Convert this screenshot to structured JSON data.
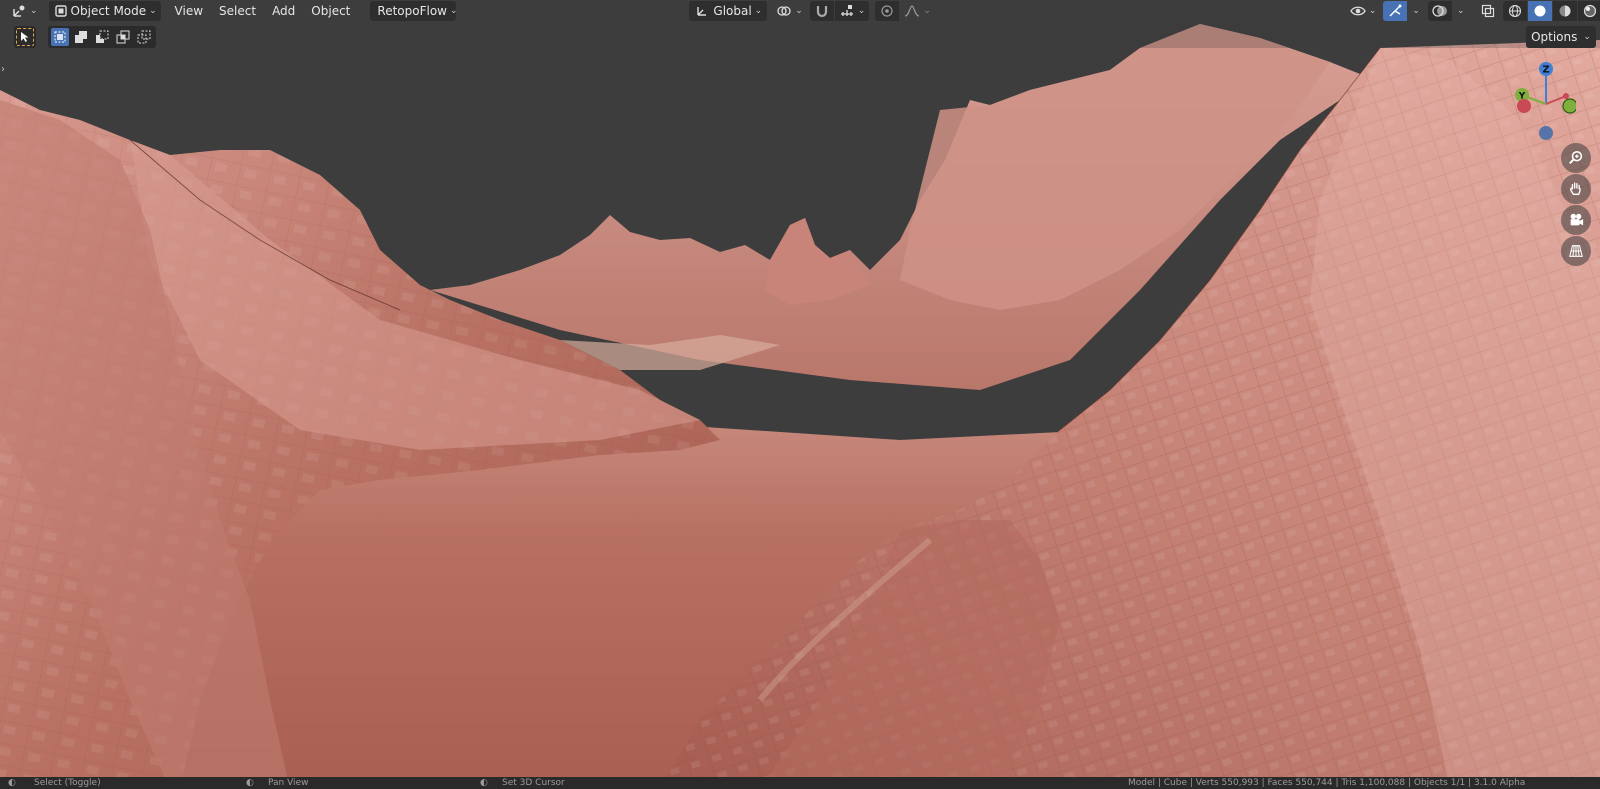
{
  "header": {
    "editor_type_icon": "3d-viewport-icon",
    "mode": {
      "icon": "object-mode-icon",
      "label": "Object Mode"
    },
    "menus": [
      "View",
      "Select",
      "Add",
      "Object"
    ],
    "addon_menu": "RetopoFlow",
    "transform_orientation": {
      "icon": "transform-orientation-icon",
      "label": "Global"
    },
    "pivot_icon": "pivot-point-icon",
    "snap_icon": "snap-magnet-icon",
    "snap_target_icon": "snap-increment-icon",
    "proportional_icon": "proportional-editing-icon",
    "falloff_icon": "falloff-curve-icon",
    "visibility_icon": "eye-icon",
    "gizmo_icon": "gizmo-toggle-icon",
    "overlay_icon": "overlays-icon",
    "xray_icon": "xray-toggle-icon",
    "shading_modes": [
      "wireframe-shading-icon",
      "solid-shading-icon",
      "material-preview-icon",
      "rendered-shading-icon"
    ],
    "active_shading": "solid-shading-icon"
  },
  "toolbar": {
    "active_tool_icon": "select-cursor-icon",
    "selection_modes": [
      "select-box-new-icon",
      "select-extend-icon",
      "select-subtract-icon",
      "select-intersect-icon"
    ]
  },
  "options_label": "Options",
  "gizmo": {
    "z_label": "Z",
    "y_label": "Y",
    "x_label": ""
  },
  "nav_buttons": [
    "zoom-magnifier-icon",
    "pan-hand-icon",
    "camera-view-icon",
    "orthographic-grid-icon"
  ],
  "colors": {
    "background": "#3d3d3d",
    "terrain_base": "#b26a5e",
    "terrain_light": "#e0a79c",
    "accent_blue": "#4772b3",
    "axis_x": "#c94a55",
    "axis_y": "#7fb03d",
    "axis_z": "#3f7fd6"
  },
  "statusbar": {
    "left": "Select (Toggle)",
    "middle1": "Pan View",
    "middle2": "Set 3D Cursor",
    "right": "Model | Cube | Verts 550,993 | Faces 550,744 | Tris 1,100,088 | Objects 1/1 | 3.1.0 Alpha"
  }
}
